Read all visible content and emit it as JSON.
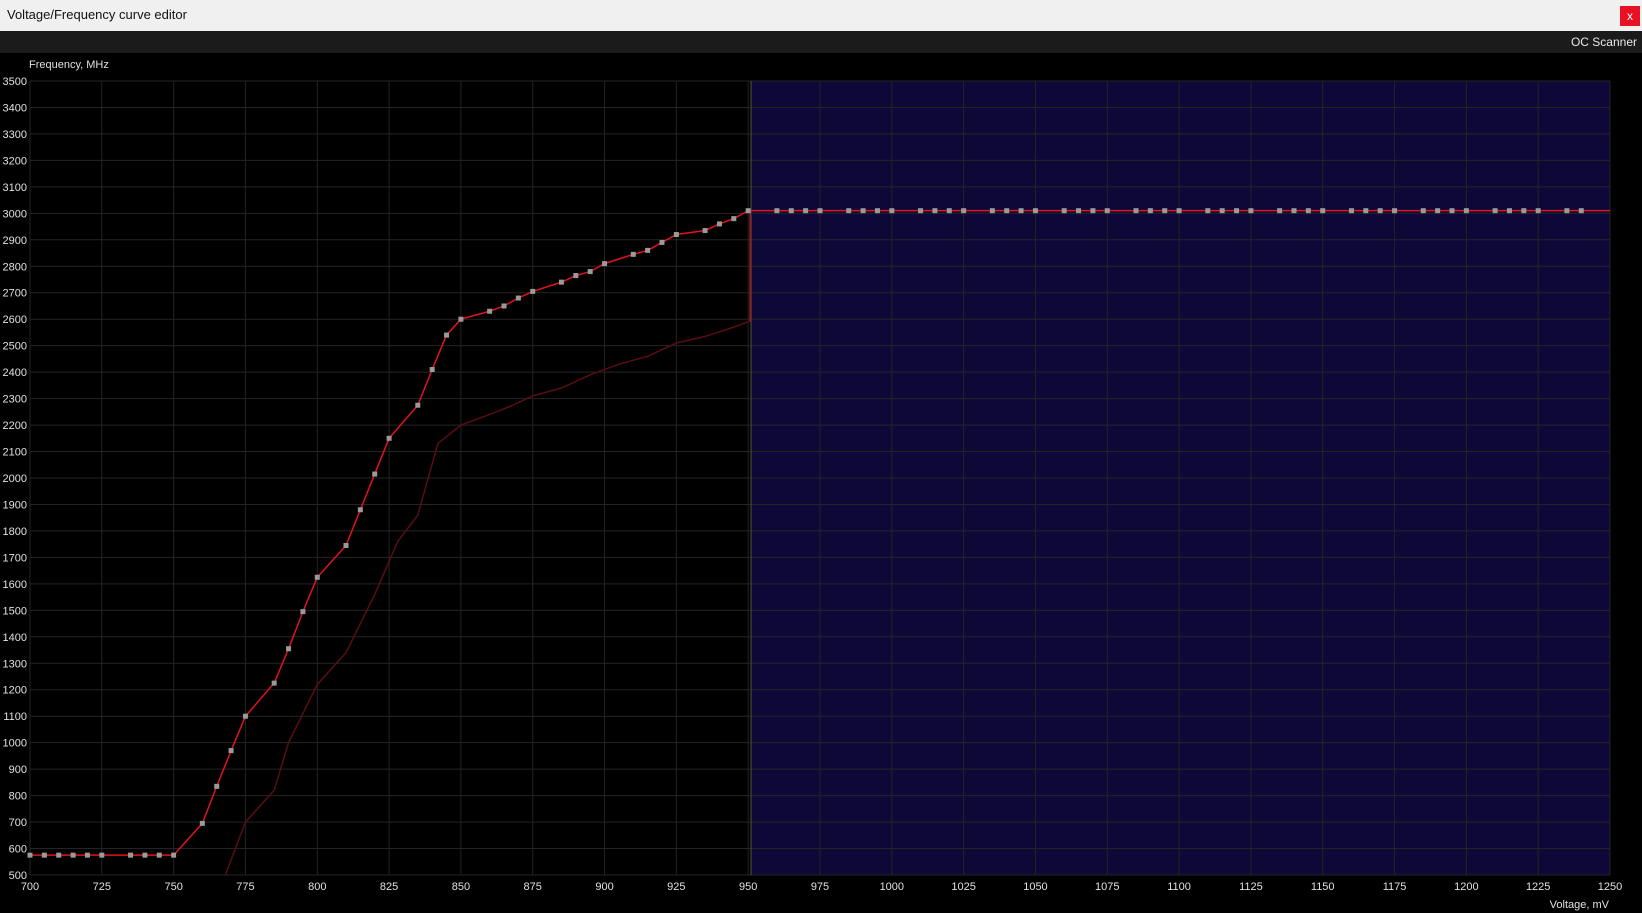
{
  "window": {
    "title": "Voltage/Frequency curve editor",
    "close_label": "x"
  },
  "toolbar": {
    "oc_scanner_label": "OC Scanner"
  },
  "colors": {
    "background": "#000000",
    "grid": "#242424",
    "locked_region": "#0d0838",
    "curve": "#e0141e",
    "baseline_curve": "#5a0d12",
    "point": "#9a9a9a",
    "lock_line": "#d0101a"
  },
  "chart_data": {
    "type": "line",
    "xlabel": "Voltage, mV",
    "ylabel": "Frequency, MHz",
    "xlim": [
      700,
      1250
    ],
    "ylim": [
      500,
      3500
    ],
    "xticks": [
      700,
      725,
      750,
      775,
      800,
      825,
      850,
      875,
      900,
      925,
      950,
      975,
      1000,
      1025,
      1050,
      1075,
      1100,
      1125,
      1150,
      1175,
      1200,
      1225,
      1250
    ],
    "yticks": [
      500,
      600,
      700,
      800,
      900,
      1000,
      1100,
      1200,
      1300,
      1400,
      1500,
      1600,
      1700,
      1800,
      1900,
      2000,
      2100,
      2200,
      2300,
      2400,
      2500,
      2600,
      2700,
      2800,
      2900,
      3000,
      3100,
      3200,
      3300,
      3400,
      3500
    ],
    "locked_voltage": 951,
    "locked_region_x": [
      951,
      1250
    ],
    "series": [
      {
        "role": "active",
        "x": [
          700,
          705,
          710,
          715,
          720,
          725,
          735,
          740,
          745,
          750,
          760,
          765,
          770,
          775,
          785,
          790,
          795,
          800,
          810,
          815,
          820,
          825,
          835,
          840,
          845,
          850,
          860,
          865,
          870,
          875,
          885,
          890,
          895,
          900,
          910,
          915,
          920,
          925,
          935,
          940,
          945,
          950,
          960,
          965,
          970,
          975,
          985,
          990,
          995,
          1000,
          1010,
          1015,
          1020,
          1025,
          1035,
          1040,
          1045,
          1050,
          1060,
          1065,
          1070,
          1075,
          1085,
          1090,
          1095,
          1100,
          1110,
          1115,
          1120,
          1125,
          1135,
          1140,
          1145,
          1150,
          1160,
          1165,
          1170,
          1175,
          1185,
          1190,
          1195,
          1200,
          1210,
          1215,
          1220,
          1225,
          1235,
          1240
        ],
        "y": [
          575,
          575,
          575,
          575,
          575,
          575,
          575,
          575,
          575,
          575,
          695,
          835,
          970,
          1100,
          1225,
          1355,
          1495,
          1625,
          1745,
          1880,
          2015,
          2150,
          2275,
          2410,
          2540,
          2600,
          2630,
          2650,
          2680,
          2705,
          2740,
          2765,
          2780,
          2810,
          2845,
          2860,
          2890,
          2920,
          2935,
          2960,
          2980,
          3010,
          3010,
          3010,
          3010,
          3010,
          3010,
          3010,
          3010,
          3010,
          3010,
          3010,
          3010,
          3010,
          3010,
          3010,
          3010,
          3010,
          3010,
          3010,
          3010,
          3010,
          3010,
          3010,
          3010,
          3010,
          3010,
          3010,
          3010,
          3010,
          3010,
          3010,
          3010,
          3010,
          3010,
          3010,
          3010,
          3010,
          3010,
          3010,
          3010,
          3010,
          3010,
          3010,
          3010,
          3010,
          3010,
          3010
        ]
      },
      {
        "role": "baseline",
        "x": [
          768,
          775,
          785,
          790,
          800,
          810,
          820,
          828,
          835,
          842,
          850,
          860,
          867,
          875,
          885,
          895,
          905,
          915,
          925,
          935,
          945,
          950
        ],
        "y": [
          500,
          700,
          820,
          1000,
          1220,
          1340,
          1560,
          1760,
          1860,
          2130,
          2200,
          2240,
          2270,
          2310,
          2340,
          2390,
          2430,
          2460,
          2510,
          2535,
          2570,
          2590
        ]
      }
    ]
  }
}
